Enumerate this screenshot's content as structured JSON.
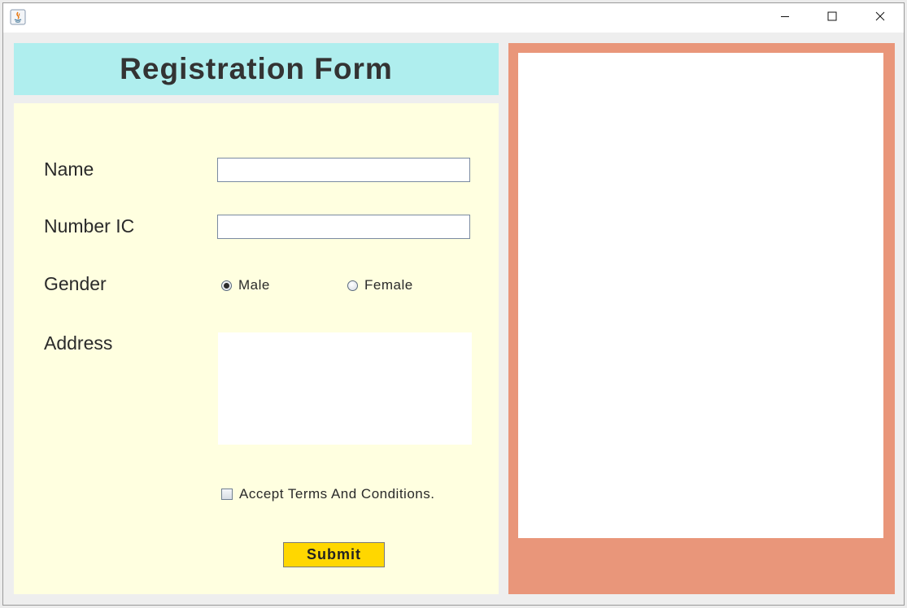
{
  "window": {
    "app_icon": "java-icon",
    "controls": [
      "minimize-icon",
      "maximize-icon",
      "close-icon"
    ]
  },
  "header": {
    "title": "Registration Form",
    "background": "#afeeee"
  },
  "form": {
    "background": "#ffffe0",
    "name_label": "Name",
    "name_value": "",
    "ic_label": "Number IC",
    "ic_value": "",
    "gender_label": "Gender",
    "gender_options": [
      {
        "label": "Male",
        "selected": true
      },
      {
        "label": "Female",
        "selected": false
      }
    ],
    "address_label": "Address",
    "address_value": "",
    "terms_label": "Accept Terms And Conditions.",
    "terms_checked": false,
    "submit_label": "Submit",
    "submit_color": "#ffd700"
  },
  "output": {
    "panel_color": "#e9967a",
    "content": ""
  }
}
